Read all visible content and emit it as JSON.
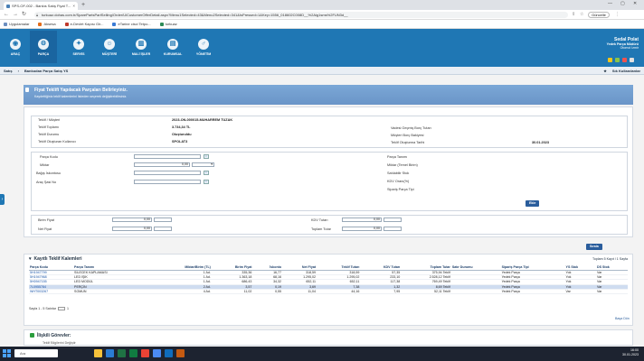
{
  "browser": {
    "tab_title": "SPS-OF-002 - Bankıs Satış Fiyat T...",
    "url": "turkuaz.dohas.com.tr/SparePartsPartSelling/Order/UiCustomerOfferDetail.aspx?Menu1Selected=43&Menu2Selected=341&IsPressed=1&Key=1556_018602C008D__%2Aig1sms%2FUN3d__",
    "profile_label": "Güncelle",
    "bookmarks": [
      "Uygulamalar",
      "Aksesa",
      "e-Devlet Kapısı Gir...",
      "eTarine cisci Tetpo...",
      "turkuaz"
    ],
    "bookmark_colors": [
      "#6c8ebf",
      "#e46d1b",
      "#c0392b",
      "#3a7bd5",
      "#2e8b57"
    ]
  },
  "app": {
    "nav": [
      {
        "label": "ARAÇ",
        "icon": "car-icon",
        "glyph": "◉"
      },
      {
        "label": "PARÇA",
        "icon": "gear-icon",
        "glyph": "⚙"
      },
      {
        "label": "SERVİS",
        "icon": "wrench-icon",
        "glyph": "✦"
      },
      {
        "label": "MÜŞTERİ",
        "icon": "customer-icon",
        "glyph": "☺"
      },
      {
        "label": "MALİ İŞLER",
        "icon": "finance-icon",
        "glyph": "▥"
      },
      {
        "label": "KURUMSAL",
        "icon": "corporate-icon",
        "glyph": "▤"
      },
      {
        "label": "YÖNETİM",
        "icon": "admin-icon",
        "glyph": "♂"
      }
    ],
    "user": {
      "name": "Sedal Polat",
      "role": "Yedek Parça Müdürü",
      "company": "Otomol İzmir"
    },
    "breadcrumb": {
      "left": "Satış",
      "section": "Bankodan Parça Satış YS",
      "right": "Sık Kullanılanlar"
    }
  },
  "panel": {
    "title": "Fiyat Teklifi Yapılacak Parçaları Belirleyiniz.",
    "subtitle": "Kaydettiğiniz teklif kalemlerini listeden seçerek değiştirebilirsiniz."
  },
  "info": {
    "left": [
      {
        "label": "Teklif / Müşteri",
        "value": "2023-ON-000015-MUHARREM TUZAK"
      },
      {
        "label": "Teklif Toplamı",
        "value": "3.734,34 TL"
      },
      {
        "label": "Teklif Durumu",
        "value": "Oluşturuldu"
      },
      {
        "label": "Teklif Oluşturan Kullanıcı",
        "value": "SPOLAT3"
      }
    ],
    "right": [
      {
        "label": "Vadesi Geçmiş Borç Tutarı",
        "value": ""
      },
      {
        "label": "Müşteri Borç Bakiyesi",
        "value": ""
      },
      {
        "label": "Teklif Oluşturma Tarihi",
        "value": "30.01.2023"
      }
    ]
  },
  "form": {
    "left": [
      {
        "label": "Parça Kodu",
        "value": ""
      },
      {
        "label": "Miktar",
        "value": "0,00"
      },
      {
        "label": "Bağış İskontosu",
        "value": ""
      },
      {
        "label": "Araç Şasi No",
        "value": ""
      }
    ],
    "right": [
      "Parça Tanımı",
      "Miktar (Temel Birim)",
      "Satılabilir Stok",
      "KDV Oranı(%)",
      "Sipariş Parça Tipi"
    ],
    "ekle": "Ekle"
  },
  "totals": {
    "birim_fiyat_label": "Birim Fiyat",
    "birim_fiyat": "0,00",
    "net_fiyat_label": "Net Fiyat",
    "net_fiyat": "0,00",
    "kdv_tutari_label": "KDV Tutarı",
    "kdv_tutari": "0,00",
    "toplam_tutar_label": "Toplam Tutar",
    "toplam_tutar": "0,00"
  },
  "table": {
    "button": "Sırala",
    "title": "Kayıtlı Teklif Kalemleri",
    "summary": "Toplam 5 Kayıt / 1 Sayfa",
    "columns": [
      "Parça Kodu",
      "Parça Tanımı",
      "Miktar/Birim (TL)",
      "Birim Fiyat",
      "İskonto",
      "Net Fiyat",
      "Teklif Tutarı",
      "KDV Tutarı",
      "Toplam Tutar",
      "Satır Durumu",
      "Sipariş Parça Tipi",
      "YS Stok",
      "DS Stok"
    ],
    "rows": [
      [
        "5H1947799",
        "SİLECEK KAPLAMASI",
        "1 Ad.",
        "335,36",
        "16,77",
        "318,59",
        "318,59",
        "57,35",
        "375,94 Teklif",
        "Yedek Parça",
        "Yok",
        "Var"
      ],
      [
        "5H1947968",
        "LED IŞIK",
        "1 Ad.",
        "1.363,18",
        "68,16",
        "1.295,02",
        "1.295,02",
        "233,10",
        "2.528,12 Teklif",
        "Yedek Parça",
        "Yok",
        "Var"
      ],
      [
        "5H0947155",
        "LED MODÜL",
        "1 Ad.",
        "686,43",
        "34,32",
        "652,11",
        "652,11",
        "117,38",
        "769,49 Teklif",
        "Yedek Parça",
        "Yok",
        "Var"
      ],
      [
        "7L0955784",
        "PERÇİN",
        "2 Ad.",
        "3,57",
        "0,19",
        "3,69",
        "7,38",
        "1,32",
        "8,69 Teklif",
        "Yedek Parça",
        "Yok",
        "Var"
      ],
      [
        "WHT003267",
        "SOMUN",
        "4 Ad.",
        "11,02",
        "0,55",
        "11,04",
        "44,16",
        "7,95",
        "52,11 Teklif",
        "Yedek Parça",
        "Var",
        "Var"
      ]
    ],
    "pager": "Sayfa 1 - 5 Satırlar",
    "pager_page": "1",
    "print": "Başa Dön"
  },
  "related": {
    "title": "İlişkili Görevler:",
    "sub": "Teklif Bilgilerini Değiştir"
  },
  "taskbar": {
    "search": "Ara",
    "time": "16:00",
    "date": "30.01.2023",
    "apps": [
      "#f7c23b",
      "#2b7cd3",
      "#1f7244",
      "#107c41",
      "#ea4335",
      "#4b8bf4",
      "#0f6cbd",
      "#c55a11"
    ]
  }
}
